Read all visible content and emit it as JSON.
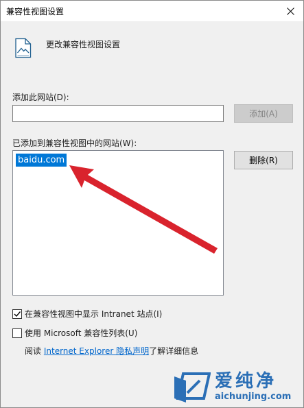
{
  "window": {
    "title": "兼容性视图设置",
    "header": "更改兼容性视图设置"
  },
  "add_site": {
    "label": "添加此网站(D):",
    "value": "",
    "button_label": "添加(A)",
    "button_enabled": false
  },
  "site_list": {
    "label": "已添加到兼容性视图中的网站(W):",
    "items": [
      "baidu.com"
    ],
    "selected_index": 0,
    "remove_label": "删除(R)"
  },
  "options": {
    "intranet": {
      "label": "在兼容性视图中显示 Intranet 站点(I)",
      "checked": true
    },
    "ms_list": {
      "label": "使用 Microsoft 兼容性列表(U)",
      "checked": false
    }
  },
  "privacy": {
    "prefix": "阅读",
    "link": "Internet Explorer 隐私声明",
    "suffix": "了解详细信息"
  },
  "watermark": {
    "brand": "爱纯净",
    "url": "aichunjing.com"
  },
  "colors": {
    "selection": "#0078d7",
    "link": "#0066cc",
    "arrow": "#d9232d",
    "watermark": "#2b6fb6"
  },
  "icons": {
    "close": "close-icon",
    "header": "compat-page-icon",
    "check": "checkmark-icon",
    "annotation": "red-arrow-icon",
    "logo": "aichunjing-logo-icon"
  }
}
